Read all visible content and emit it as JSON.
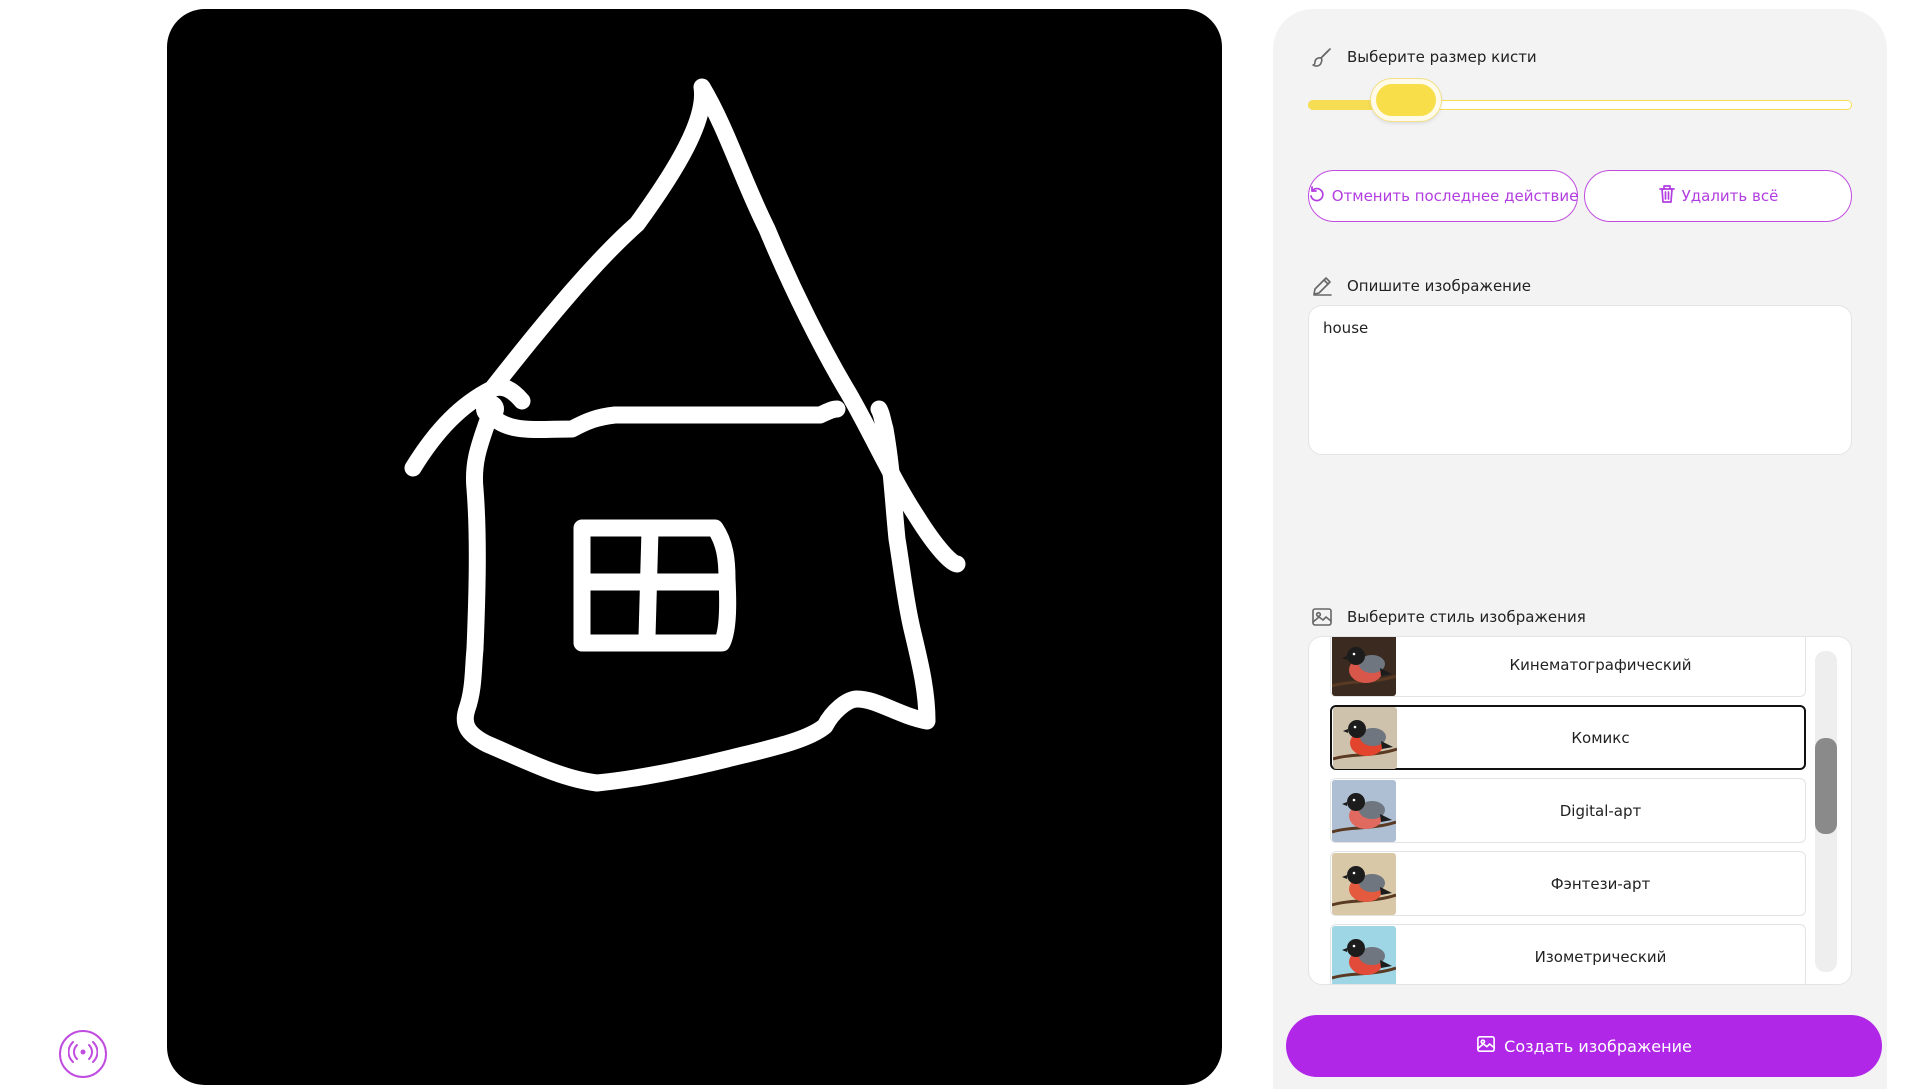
{
  "brush": {
    "title": "Выберите размер кисти",
    "icon": "brush-icon",
    "size_fraction": 0.18,
    "accent": "#f6dd54"
  },
  "actions": {
    "undo_label": "Отменить последнее действие",
    "undo_icon": "undo-icon",
    "clear_label": "Удалить всё",
    "clear_icon": "trash-icon"
  },
  "prompt": {
    "title": "Опишите изображение",
    "icon": "pencil-icon",
    "value": "house"
  },
  "styles": {
    "title": "Выберите стиль изображения",
    "icon": "image-icon",
    "selected": "Комикс",
    "items": [
      {
        "label": "Кинематографический",
        "bg": "#3a2a20",
        "body": "#d8574a"
      },
      {
        "label": "Комикс",
        "bg": "#cfc2ad",
        "body": "#e2442d"
      },
      {
        "label": "Digital-арт",
        "bg": "#aebfd3",
        "body": "#e06a60"
      },
      {
        "label": "Фэнтези-арт",
        "bg": "#d8c8a8",
        "body": "#e35a3e"
      },
      {
        "label": "Изометрический",
        "bg": "#9fd6e6",
        "body": "#e24a3a"
      }
    ]
  },
  "create_button": {
    "label": "Создать изображение",
    "icon": "image-icon",
    "color": "#b027e8"
  },
  "canvas": {
    "background": "#000000",
    "stroke": "#ffffff"
  },
  "broadcast_button": {
    "icon": "broadcast-icon",
    "color": "#c04de0"
  }
}
